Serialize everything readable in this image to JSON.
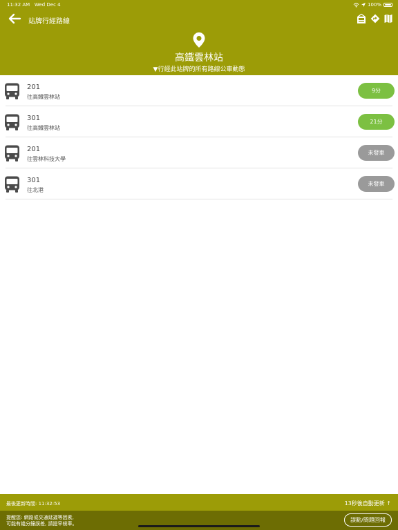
{
  "status_bar": {
    "time": "11:32 AM",
    "date": "Wed Dec 4",
    "battery": "100%"
  },
  "nav": {
    "title": "站牌行經路線"
  },
  "stop": {
    "name": "高鐵雲林站",
    "subtitle": "▼行經此站牌的所有路線公車動態"
  },
  "routes": [
    {
      "number": "201",
      "destination": "往高鐵雲林站",
      "eta": "9分",
      "status": "active"
    },
    {
      "number": "301",
      "destination": "往高鐵雲林站",
      "eta": "21分",
      "status": "active"
    },
    {
      "number": "201",
      "destination": "往雲林科技大學",
      "eta": "未發車",
      "status": "idle"
    },
    {
      "number": "301",
      "destination": "往北港",
      "eta": "未發車",
      "status": "idle"
    }
  ],
  "footer": {
    "last_updated": "最後更新時間: 11:32:53",
    "auto_refresh": "13秒後自動更新 ↑",
    "notice_line1": "提醒您: 網路或交通延遲等因素,",
    "notice_line2": "可能有幾分鐘誤差, 請提早候車。",
    "report_label": "誤點/問題回報"
  },
  "colors": {
    "header": "#9c9c07",
    "footer_dark": "#6d6d03",
    "eta_active": "#7cc042",
    "eta_idle": "#9a9a9a"
  },
  "icons": [
    "back-arrow-icon",
    "bus-stop-sign-icon",
    "directions-icon",
    "map-icon",
    "location-pin-icon",
    "bus-icon",
    "wifi-icon",
    "battery-icon"
  ]
}
